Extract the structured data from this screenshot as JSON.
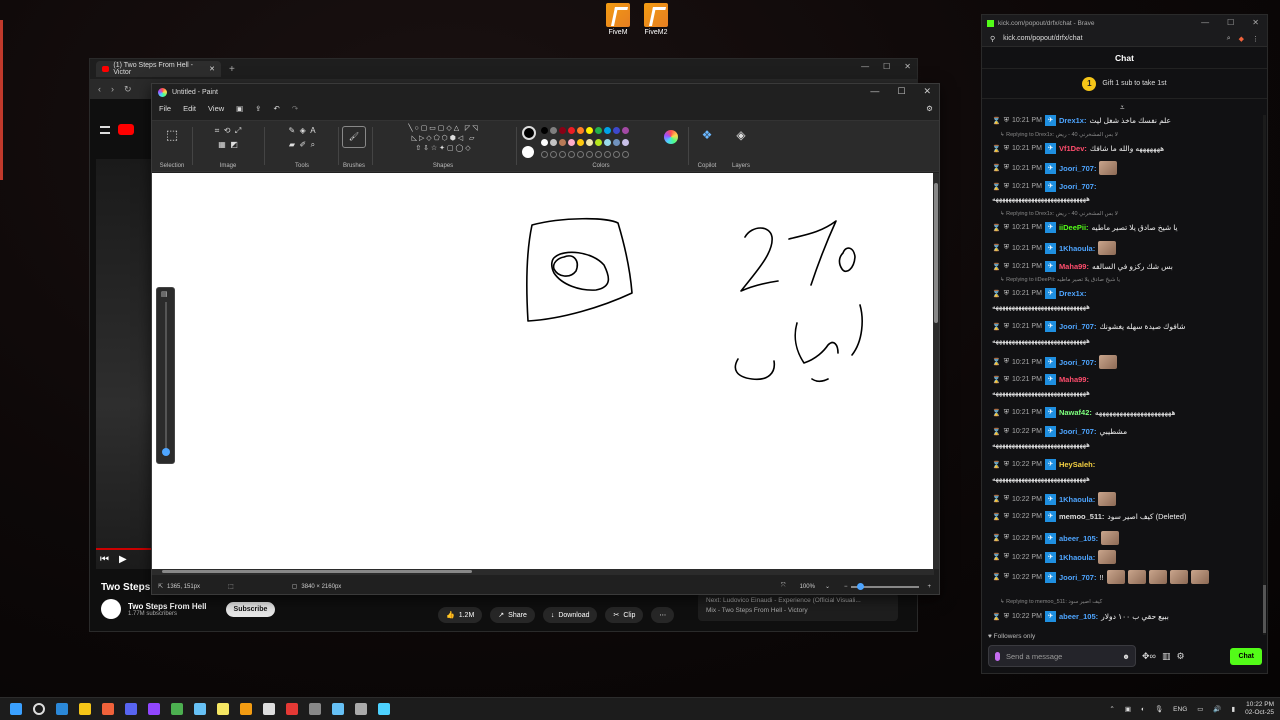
{
  "desktop": {
    "icons": [
      {
        "label": "FiveM",
        "icon": "fivem-icon"
      },
      {
        "label": "FiveM2",
        "icon": "fivem-icon"
      }
    ]
  },
  "browser": {
    "tab_title": "(1) Two Steps From Hell - Victor",
    "youtube": {
      "video_title": "Two Steps",
      "channel_name": "Two Steps From Hell",
      "subscribers": "1.77M subscribers",
      "subscribe_label": "Subscribe",
      "likes": "1.2M",
      "share_label": "Share",
      "download_label": "Download",
      "clip_label": "Clip",
      "next_label": "Next: Ludovico Einaudi - Experience (Official Visuali...",
      "next_sub": "Mix - Two Steps From Hell - Victory"
    }
  },
  "paint": {
    "title": "Untitled - Paint",
    "menu": [
      "File",
      "Edit",
      "View"
    ],
    "groups": [
      "Selection",
      "Image",
      "Tools",
      "Brushes",
      "Shapes",
      "Colors",
      "Copilot",
      "Layers"
    ],
    "palette_row1": [
      "#000000",
      "#7f7f7f",
      "#880015",
      "#ed1c24",
      "#ff7f27",
      "#fff200",
      "#22b14c",
      "#00a2e8",
      "#3f48cc",
      "#a349a4"
    ],
    "palette_row2": [
      "#ffffff",
      "#c3c3c3",
      "#b97a57",
      "#ffaec9",
      "#ffc90e",
      "#efe4b0",
      "#b5e61d",
      "#99d9ea",
      "#7092be",
      "#c8bfe7"
    ],
    "status": {
      "cursor": "1365, 151px",
      "canvas_size": "3840 × 2160px",
      "zoom": "100%"
    }
  },
  "chat": {
    "window_url": "kick.com/popout/drfx/chat - Brave",
    "address": "kick.com/popout/drfx/chat",
    "header": "Chat",
    "gift_text": "Gift 1 sub to take 1st",
    "gift_count": "1",
    "messages": [
      {
        "time": "10:21 PM",
        "user": "Drex1x",
        "color": "#4ea5ff",
        "text": "علم نفسك ماخذ شغل ليث",
        "emotes": 0
      },
      {
        "time": "10:21 PM",
        "user": "Vf1Dev",
        "color": "#ff4d6d",
        "text": "هههههههه والله ما شافك",
        "emotes": 0
      },
      {
        "time": "10:21 PM",
        "user": "Joori_707",
        "color": "#4ea5ff",
        "text": "",
        "emotes": 1
      },
      {
        "time": "10:21 PM",
        "user": "Joori_707",
        "color": "#4ea5ff",
        "text": "",
        "emotes": 0
      },
      {
        "time": "10:21 PM",
        "user": "iiDeePii",
        "color": "#53fc18",
        "text": "يا شيخ صادق يلا تصير ماطيه",
        "emotes": 0
      },
      {
        "time": "10:21 PM",
        "user": "1Khaoula",
        "color": "#4ea5ff",
        "text": "",
        "emotes": 1
      },
      {
        "time": "10:21 PM",
        "user": "Maha99",
        "color": "#ff4d6d",
        "text": "بس شك ركزو في السالفه",
        "emotes": 0
      },
      {
        "time": "10:21 PM",
        "user": "Drex1x",
        "color": "#4ea5ff",
        "text": "",
        "emotes": 0
      },
      {
        "time": "10:21 PM",
        "user": "Joori_707",
        "color": "#4ea5ff",
        "text": "شافوك صيدة سهله يغشونك",
        "emotes": 0
      },
      {
        "time": "10:21 PM",
        "user": "Joori_707",
        "color": "#4ea5ff",
        "text": "",
        "emotes": 1
      },
      {
        "time": "10:21 PM",
        "user": "Maha99",
        "color": "#ff4d6d",
        "text": "",
        "emotes": 0
      },
      {
        "time": "10:21 PM",
        "user": "Nawaf42",
        "color": "#7dff7d",
        "text": "ههههههههههههههههههههههه",
        "emotes": 0
      },
      {
        "time": "10:22 PM",
        "user": "Joori_707",
        "color": "#4ea5ff",
        "text": "مشطيبي",
        "emotes": 0
      },
      {
        "time": "10:22 PM",
        "user": "HeySaleh",
        "color": "#f5d142",
        "text": "",
        "emotes": 0
      },
      {
        "time": "10:22 PM",
        "user": "1Khaoula",
        "color": "#4ea5ff",
        "text": "",
        "emotes": 1
      },
      {
        "time": "10:22 PM",
        "user": "memoo_511",
        "color": "#dddddd",
        "text": "كيف اصير سود (Deleted)",
        "emotes": 0
      },
      {
        "time": "10:22 PM",
        "user": "abeer_105",
        "color": "#4ea5ff",
        "text": "",
        "emotes": 1
      },
      {
        "time": "10:22 PM",
        "user": "1Khaoula",
        "color": "#4ea5ff",
        "text": "",
        "emotes": 1
      },
      {
        "time": "10:22 PM",
        "user": "Joori_707",
        "color": "#4ea5ff",
        "text": "!!",
        "emotes": 5
      },
      {
        "time": "10:22 PM",
        "user": "abeer_105",
        "color": "#4ea5ff",
        "text": "ببيع حقي ب ١٠٠ دولار",
        "emotes": 0
      }
    ],
    "replies": [
      "Replying to Drex1x: لا بس المشخرني 40 - ريض",
      "Replying to Drex1x: لا بس المشخرني 40 - ريض",
      "Replying to iiDeePii: يا شيخ صادق يلا تصير ماطيه",
      "Replying to memoo_511: كيف اصير سود"
    ],
    "continuation": "هههههههههههههههههههههههههههههه",
    "followers_only": "Followers only",
    "input_placeholder": "Send a message",
    "send_label": "Chat"
  },
  "taskbar": {
    "language": "ENG",
    "time": "10:22 PM",
    "date": "02-Oct-25"
  }
}
